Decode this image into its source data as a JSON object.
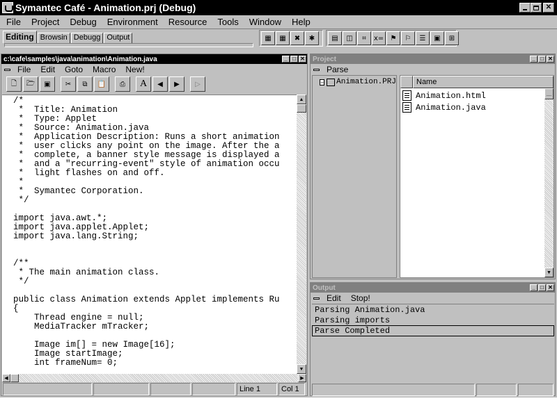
{
  "window": {
    "title": "Symantec Café - Animation.prj (Debug)"
  },
  "menubar": {
    "items": [
      {
        "label": "File"
      },
      {
        "label": "Project"
      },
      {
        "label": "Debug"
      },
      {
        "label": "Environment"
      },
      {
        "label": "Resource"
      },
      {
        "label": "Tools"
      },
      {
        "label": "Window"
      },
      {
        "label": "Help"
      }
    ]
  },
  "workspace_tabs": [
    {
      "label": "Editing",
      "active": true
    },
    {
      "label": "Browsin"
    },
    {
      "label": "Debugg"
    },
    {
      "label": "Output"
    }
  ],
  "editor": {
    "title": "c:\\cafe\\samples\\java\\animation\\Animation.java",
    "menu": [
      {
        "label": "File"
      },
      {
        "label": "Edit"
      },
      {
        "label": "Goto"
      },
      {
        "label": "Macro"
      },
      {
        "label": "New!"
      }
    ],
    "toolbar_icons": [
      "new-file-icon",
      "open-file-icon",
      "save-icon",
      "cut-icon",
      "copy-icon",
      "paste-icon",
      "print-icon",
      "find-icon",
      "find-prev-icon",
      "find-next-icon",
      "run-icon"
    ],
    "code_lines": [
      "/*",
      " *  Title: Animation",
      " *  Type: Applet",
      " *  Source: Animation.java",
      " *  Application Description: Runs a short animation",
      " *  user clicks any point on the image. After the a",
      " *  complete, a banner style message is displayed a",
      " *  and a \"recurring-event\" style of animation occu",
      " *  light flashes on and off.",
      " *",
      " *  Symantec Corporation.",
      " */",
      "",
      "import java.awt.*;",
      "import java.applet.Applet;",
      "import java.lang.String;",
      "",
      "",
      "/**",
      " * The main animation class.",
      " */",
      "",
      "public class Animation extends Applet implements Ru",
      "{",
      "    Thread engine = null;",
      "    MediaTracker mTracker;",
      "",
      "    Image im[] = new Image[16];",
      "    Image startImage;",
      "    int frameNum= 0;"
    ],
    "status": {
      "line": "Line 1",
      "col": "Col 1"
    }
  },
  "project": {
    "title": "Project",
    "menu": [
      {
        "label": "Parse"
      }
    ],
    "tree_root": "Animation.PRJ",
    "column_header": "Name",
    "files": [
      {
        "name": "Animation.html"
      },
      {
        "name": "Animation.java"
      }
    ]
  },
  "output": {
    "title": "Output",
    "menu": [
      {
        "label": "Edit"
      },
      {
        "label": "Stop!"
      }
    ],
    "lines": [
      "Parsing Animation.java",
      "Parsing imports",
      "Parse Completed"
    ]
  }
}
